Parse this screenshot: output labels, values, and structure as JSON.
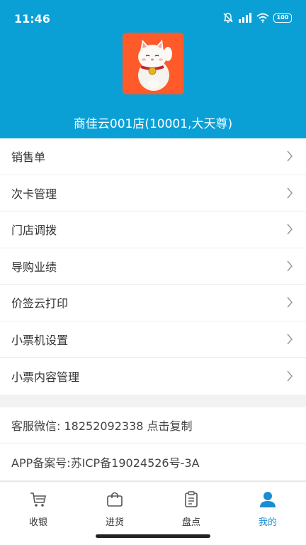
{
  "status_bar": {
    "time": "11:46",
    "battery": "100"
  },
  "header": {
    "store_name": "商佳云001店(10001,大天尊)",
    "bg_color": "#0aa0d6"
  },
  "menu": {
    "items": [
      {
        "label": "销售单"
      },
      {
        "label": "次卡管理"
      },
      {
        "label": "门店调拨"
      },
      {
        "label": "导购业绩"
      },
      {
        "label": "价签云打印"
      },
      {
        "label": "小票机设置"
      },
      {
        "label": "小票内容管理"
      }
    ]
  },
  "info": {
    "service_wechat": "客服微信: 18252092338 点击复制",
    "icp": "APP备案号:苏ICP备19024526号-3A"
  },
  "tabbar": {
    "tabs": [
      {
        "label": "收银",
        "icon": "cart-icon"
      },
      {
        "label": "进货",
        "icon": "bag-icon"
      },
      {
        "label": "盘点",
        "icon": "clipboard-icon"
      },
      {
        "label": "我的",
        "icon": "user-icon"
      }
    ],
    "active": "我的",
    "active_color": "#1a8ed0"
  }
}
